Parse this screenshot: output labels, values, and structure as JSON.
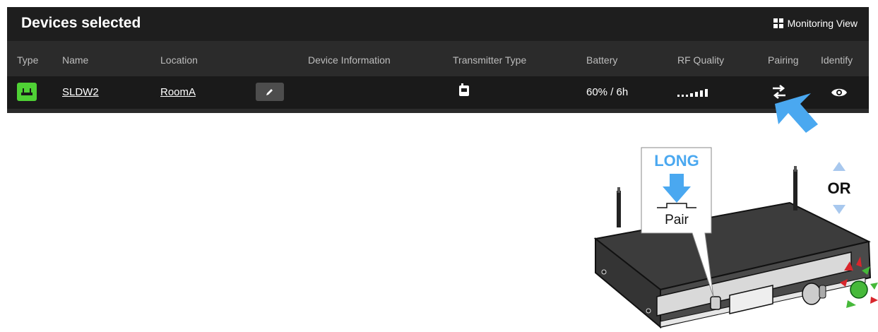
{
  "header": {
    "title": "Devices selected",
    "monitoring_view_label": "Monitoring View"
  },
  "columns": [
    "Type",
    "Name",
    "Location",
    "Device Information",
    "Transmitter Type",
    "Battery",
    "RF Quality",
    "Pairing",
    "Identify"
  ],
  "device_row": {
    "name": "SLDW2",
    "location": "RoomA",
    "device_information": "",
    "battery": "60% / 6h",
    "type_icon": "receiver-icon",
    "transmitter_icon": "bodypack-icon",
    "rf_quality_icon": "signal-bars-icon",
    "pairing_icon": "pairing-arrows-icon",
    "identify_icon": "eye-icon"
  },
  "illustration": {
    "long_label": "LONG",
    "pair_label": "Pair",
    "or_label": "OR"
  },
  "colors": {
    "accent_blue": "#4aa8f0",
    "status_green": "#4fd135",
    "led_red": "#d8262c",
    "led_green": "#46b93a"
  }
}
